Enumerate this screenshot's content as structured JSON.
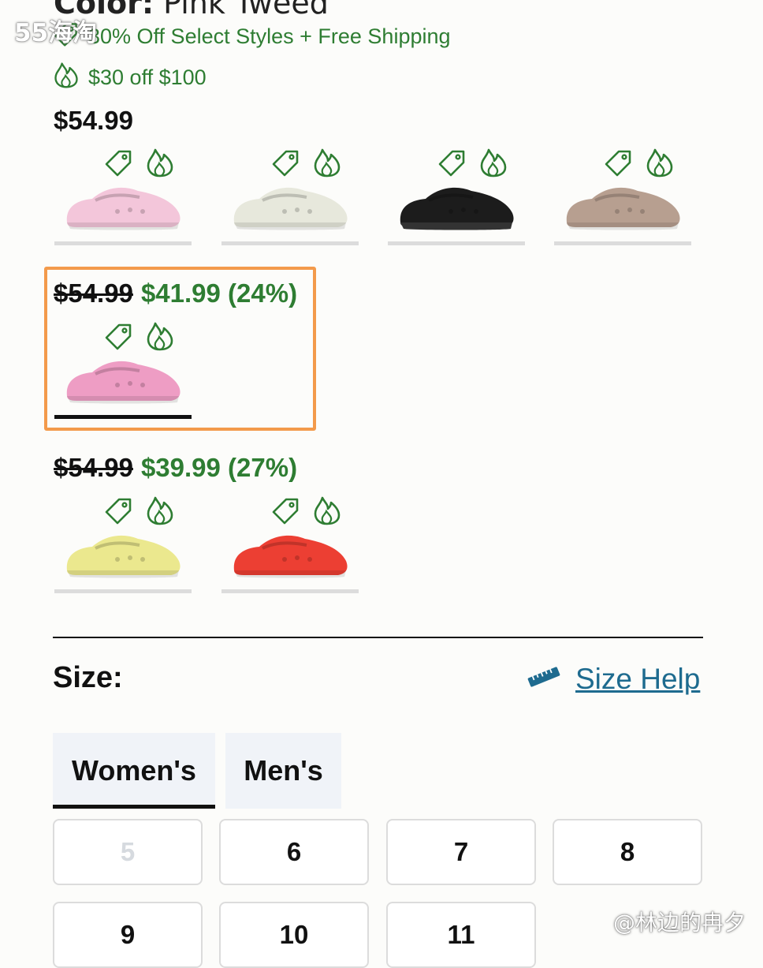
{
  "color": {
    "label": "Color:",
    "value": "Pink Tweed"
  },
  "promos": [
    {
      "icon": "tag-icon",
      "text": "30% Off Select Styles + Free Shipping"
    },
    {
      "icon": "flame-icon",
      "text": "$30 off $100"
    }
  ],
  "groups": [
    {
      "price": "$54.99",
      "original": "",
      "sale": "",
      "swatches": [
        {
          "name": "Light Pink",
          "shoe_color": "#f3c6da",
          "selected": false
        },
        {
          "name": "Cream",
          "shoe_color": "#e7e8dc",
          "selected": false
        },
        {
          "name": "Black",
          "shoe_color": "#1c1c1c",
          "selected": false
        },
        {
          "name": "Mushroom",
          "shoe_color": "#b79f90",
          "selected": false
        }
      ]
    },
    {
      "price": "",
      "original": "$54.99",
      "sale": "$41.99 (24%)",
      "swatches": [
        {
          "name": "Pink Tweed",
          "shoe_color": "#ee9dc4",
          "selected": true
        }
      ]
    },
    {
      "price": "",
      "original": "$54.99",
      "sale": "$39.99 (27%)",
      "swatches": [
        {
          "name": "Yellow",
          "shoe_color": "#ebe88e",
          "selected": false
        },
        {
          "name": "Red",
          "shoe_color": "#ec3f33",
          "selected": false
        }
      ]
    }
  ],
  "size": {
    "label": "Size:",
    "help_label": "Size Help",
    "tabs": [
      {
        "label": "Women's",
        "active": true
      },
      {
        "label": "Men's",
        "active": false
      }
    ],
    "options": [
      {
        "label": "5",
        "available": false
      },
      {
        "label": "6",
        "available": true
      },
      {
        "label": "7",
        "available": true
      },
      {
        "label": "8",
        "available": true
      },
      {
        "label": "9",
        "available": true
      },
      {
        "label": "10",
        "available": true
      },
      {
        "label": "11",
        "available": true
      }
    ]
  },
  "watermarks": {
    "top_left": "55海淘",
    "bottom_right": "@林边的冉夕"
  },
  "colors": {
    "accent_green": "#2e7d32",
    "link_blue": "#1e6b8f",
    "selection_orange": "#f39a4b"
  }
}
